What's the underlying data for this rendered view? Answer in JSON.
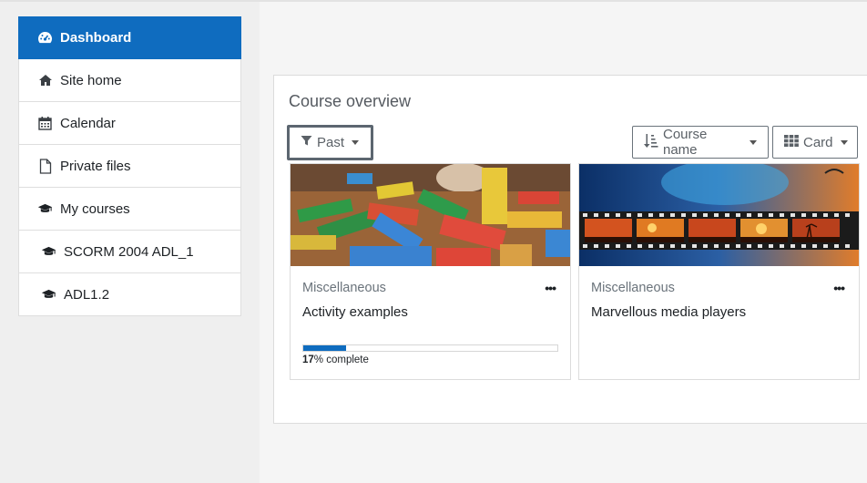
{
  "sidebar": {
    "items": [
      {
        "label": "Dashboard",
        "icon": "dashboard-icon",
        "active": true
      },
      {
        "label": "Site home",
        "icon": "home-icon"
      },
      {
        "label": "Calendar",
        "icon": "calendar-icon"
      },
      {
        "label": "Private files",
        "icon": "file-icon"
      },
      {
        "label": "My courses",
        "icon": "graduation-cap-icon"
      },
      {
        "label": "SCORM 2004 ADL_1",
        "icon": "graduation-cap-icon"
      },
      {
        "label": "ADL1.2",
        "icon": "graduation-cap-icon"
      }
    ]
  },
  "overview": {
    "title": "Course overview",
    "filter_label": "Past",
    "sort_label": "Course name",
    "view_label": "Card"
  },
  "courses": [
    {
      "category": "Miscellaneous",
      "name": "Activity examples",
      "menu": "•••",
      "progress_percent": 17,
      "progress_suffix": "% complete",
      "progress_value": "17"
    },
    {
      "category": "Miscellaneous",
      "name": "Marvellous media players",
      "menu": "•••"
    }
  ],
  "colors": {
    "accent": "#0f6cbf"
  }
}
